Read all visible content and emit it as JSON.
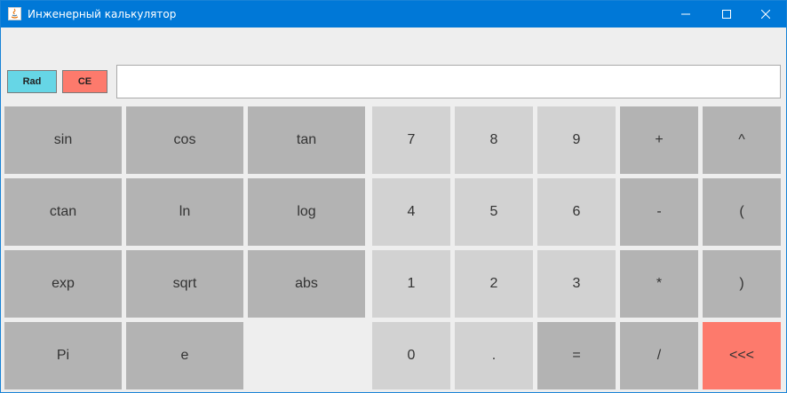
{
  "window": {
    "title": "Инженерный калькулятор"
  },
  "toolbar": {
    "rad_label": "Rad",
    "ce_label": "CE"
  },
  "display": {
    "value": ""
  },
  "keys": {
    "sin": "sin",
    "cos": "cos",
    "tan": "tan",
    "ctan": "ctan",
    "ln": "ln",
    "log": "log",
    "exp": "exp",
    "sqrt": "sqrt",
    "abs": "abs",
    "pi": "Pi",
    "e": "e",
    "d7": "7",
    "d8": "8",
    "d9": "9",
    "d4": "4",
    "d5": "5",
    "d6": "6",
    "d1": "1",
    "d2": "2",
    "d3": "3",
    "d0": "0",
    "dot": ".",
    "plus": "+",
    "minus": "-",
    "mul": "*",
    "div": "/",
    "pow": "^",
    "lparen": "(",
    "rparen": ")",
    "equals": "=",
    "backspace": "<<<"
  },
  "colors": {
    "titlebar": "#0078d7",
    "rad": "#66d6e6",
    "ce": "#fd7a6c",
    "function_key": "#b3b3b3",
    "digit_key": "#d2d2d2",
    "backspace": "#fd7a6c"
  }
}
